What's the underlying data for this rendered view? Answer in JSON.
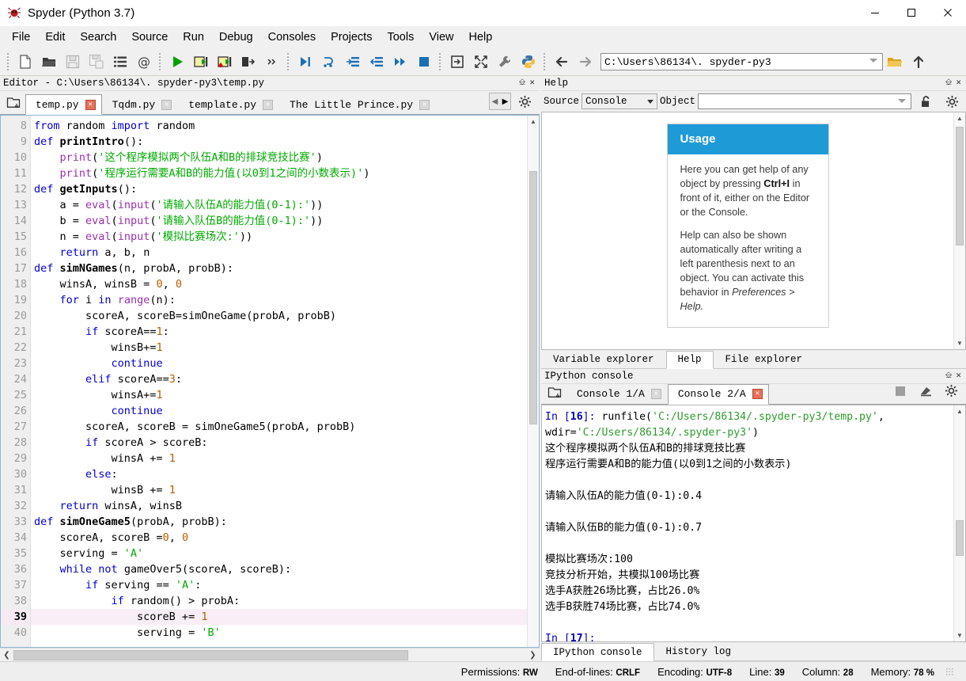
{
  "window": {
    "title": "Spyder (Python 3.7)",
    "app_icon": "spyder-icon",
    "minimize": "–",
    "maximize": "□",
    "close": "✕"
  },
  "menubar": {
    "items": [
      {
        "label": "File",
        "name": "menu-file"
      },
      {
        "label": "Edit",
        "name": "menu-edit"
      },
      {
        "label": "Search",
        "name": "menu-search"
      },
      {
        "label": "Source",
        "name": "menu-source"
      },
      {
        "label": "Run",
        "name": "menu-run"
      },
      {
        "label": "Debug",
        "name": "menu-debug"
      },
      {
        "label": "Consoles",
        "name": "menu-consoles"
      },
      {
        "label": "Projects",
        "name": "menu-projects"
      },
      {
        "label": "Tools",
        "name": "menu-tools"
      },
      {
        "label": "View",
        "name": "menu-view"
      },
      {
        "label": "Help",
        "name": "menu-help"
      }
    ]
  },
  "toolbar": {
    "path_value": "C:\\Users\\86134\\. spyder-py3",
    "icons": [
      "new-file-icon",
      "open-file-icon",
      "save-file-icon",
      "save-all-icon",
      "file-switcher-icon",
      "find-symbol-icon",
      "run-icon",
      "run-cell-icon",
      "run-cell-advance-icon",
      "run-selection-icon",
      "more-options-icon",
      "debug-icon",
      "step-over-icon",
      "step-into-icon",
      "step-return-icon",
      "continue-icon",
      "stop-debug-icon",
      "maximize-pane-icon",
      "fullscreen-icon",
      "preferences-icon",
      "pythonpath-icon",
      "back-icon",
      "forward-icon",
      "browse-folder-icon",
      "parent-dir-icon"
    ]
  },
  "editor": {
    "pane_title": "Editor - C:\\Users\\86134\\. spyder-py3\\temp.py",
    "tabs": [
      {
        "label": "temp.py",
        "active": true
      },
      {
        "label": "Tqdm.py",
        "active": false
      },
      {
        "label": "template.py",
        "active": false
      },
      {
        "label": "The Little Prince.py",
        "active": false
      }
    ],
    "current_line": 39,
    "first_line": 8,
    "lines": [
      {
        "n": 8,
        "tokens": [
          [
            "k",
            "from"
          ],
          [
            "id",
            " random "
          ],
          [
            "k",
            "import"
          ],
          [
            "id",
            " random"
          ]
        ]
      },
      {
        "n": 9,
        "tokens": [
          [
            "k",
            "def"
          ],
          [
            "id",
            " "
          ],
          [
            "fn",
            "printIntro"
          ],
          [
            "op",
            "():"
          ]
        ]
      },
      {
        "n": 10,
        "tokens": [
          [
            "id",
            "    "
          ],
          [
            "bi",
            "print"
          ],
          [
            "op",
            "("
          ],
          [
            "st",
            "'这个程序模拟两个队伍A和B的排球竞技比赛'"
          ],
          [
            "op",
            ")"
          ]
        ]
      },
      {
        "n": 11,
        "tokens": [
          [
            "id",
            "    "
          ],
          [
            "bi",
            "print"
          ],
          [
            "op",
            "("
          ],
          [
            "st",
            "'程序运行需要A和B的能力值(以0到1之间的小数表示)'"
          ],
          [
            "op",
            ")"
          ]
        ]
      },
      {
        "n": 12,
        "tokens": [
          [
            "k",
            "def"
          ],
          [
            "id",
            " "
          ],
          [
            "fn",
            "getInputs"
          ],
          [
            "op",
            "():"
          ]
        ]
      },
      {
        "n": 13,
        "tokens": [
          [
            "id",
            "    a = "
          ],
          [
            "bi",
            "eval"
          ],
          [
            "op",
            "("
          ],
          [
            "bi",
            "input"
          ],
          [
            "op",
            "("
          ],
          [
            "st",
            "'请输入队伍A的能力值(0-1):'"
          ],
          [
            "op",
            "))"
          ]
        ]
      },
      {
        "n": 14,
        "tokens": [
          [
            "id",
            "    b = "
          ],
          [
            "bi",
            "eval"
          ],
          [
            "op",
            "("
          ],
          [
            "bi",
            "input"
          ],
          [
            "op",
            "("
          ],
          [
            "st",
            "'请输入队伍B的能力值(0-1):'"
          ],
          [
            "op",
            "))"
          ]
        ]
      },
      {
        "n": 15,
        "tokens": [
          [
            "id",
            "    n = "
          ],
          [
            "bi",
            "eval"
          ],
          [
            "op",
            "("
          ],
          [
            "bi",
            "input"
          ],
          [
            "op",
            "("
          ],
          [
            "st",
            "'模拟比赛场次:'"
          ],
          [
            "op",
            "))"
          ]
        ]
      },
      {
        "n": 16,
        "tokens": [
          [
            "id",
            "    "
          ],
          [
            "k",
            "return"
          ],
          [
            "id",
            " a, b, n"
          ]
        ]
      },
      {
        "n": 17,
        "tokens": [
          [
            "k",
            "def"
          ],
          [
            "id",
            " "
          ],
          [
            "fn",
            "simNGames"
          ],
          [
            "op",
            "(n, probA, probB):"
          ]
        ]
      },
      {
        "n": 18,
        "tokens": [
          [
            "id",
            "    winsA, winsB = "
          ],
          [
            "nm",
            "0"
          ],
          [
            "op",
            ", "
          ],
          [
            "nm",
            "0"
          ]
        ]
      },
      {
        "n": 19,
        "tokens": [
          [
            "id",
            "    "
          ],
          [
            "k",
            "for"
          ],
          [
            "id",
            " i "
          ],
          [
            "k",
            "in"
          ],
          [
            "id",
            " "
          ],
          [
            "bi",
            "range"
          ],
          [
            "op",
            "(n):"
          ]
        ]
      },
      {
        "n": 20,
        "tokens": [
          [
            "id",
            "        scoreA, scoreB=simOneGame(probA, probB)"
          ]
        ]
      },
      {
        "n": 21,
        "tokens": [
          [
            "id",
            "        "
          ],
          [
            "k",
            "if"
          ],
          [
            "id",
            " scoreA=="
          ],
          [
            "nm",
            "1"
          ],
          [
            "op",
            ":"
          ]
        ]
      },
      {
        "n": 22,
        "tokens": [
          [
            "id",
            "            winsB+="
          ],
          [
            "nm",
            "1"
          ]
        ]
      },
      {
        "n": 23,
        "tokens": [
          [
            "id",
            "            "
          ],
          [
            "k",
            "continue"
          ]
        ]
      },
      {
        "n": 24,
        "tokens": [
          [
            "id",
            "        "
          ],
          [
            "k",
            "elif"
          ],
          [
            "id",
            " scoreA=="
          ],
          [
            "nm",
            "3"
          ],
          [
            "op",
            ":"
          ]
        ]
      },
      {
        "n": 25,
        "tokens": [
          [
            "id",
            "            winsA+="
          ],
          [
            "nm",
            "1"
          ]
        ]
      },
      {
        "n": 26,
        "tokens": [
          [
            "id",
            "            "
          ],
          [
            "k",
            "continue"
          ]
        ]
      },
      {
        "n": 27,
        "tokens": [
          [
            "id",
            "        scoreA, scoreB = simOneGame5(probA, probB)"
          ]
        ]
      },
      {
        "n": 28,
        "tokens": [
          [
            "id",
            "        "
          ],
          [
            "k",
            "if"
          ],
          [
            "id",
            " scoreA > scoreB:"
          ]
        ]
      },
      {
        "n": 29,
        "tokens": [
          [
            "id",
            "            winsA += "
          ],
          [
            "nm",
            "1"
          ]
        ]
      },
      {
        "n": 30,
        "tokens": [
          [
            "id",
            "        "
          ],
          [
            "k",
            "else"
          ],
          [
            "op",
            ":"
          ]
        ]
      },
      {
        "n": 31,
        "tokens": [
          [
            "id",
            "            winsB += "
          ],
          [
            "nm",
            "1"
          ]
        ]
      },
      {
        "n": 32,
        "tokens": [
          [
            "id",
            "    "
          ],
          [
            "k",
            "return"
          ],
          [
            "id",
            " winsA, winsB"
          ]
        ]
      },
      {
        "n": 33,
        "tokens": [
          [
            "k",
            "def"
          ],
          [
            "id",
            " "
          ],
          [
            "fn",
            "simOneGame5"
          ],
          [
            "op",
            "(probA, probB):"
          ]
        ]
      },
      {
        "n": 34,
        "tokens": [
          [
            "id",
            "    scoreA, scoreB ="
          ],
          [
            "nm",
            "0"
          ],
          [
            "op",
            ", "
          ],
          [
            "nm",
            "0"
          ]
        ]
      },
      {
        "n": 35,
        "tokens": [
          [
            "id",
            "    serving = "
          ],
          [
            "st",
            "'A'"
          ]
        ]
      },
      {
        "n": 36,
        "tokens": [
          [
            "id",
            "    "
          ],
          [
            "k",
            "while"
          ],
          [
            "id",
            " "
          ],
          [
            "k",
            "not"
          ],
          [
            "id",
            " gameOver5(scoreA, scoreB):"
          ]
        ]
      },
      {
        "n": 37,
        "tokens": [
          [
            "id",
            "        "
          ],
          [
            "k",
            "if"
          ],
          [
            "id",
            " serving == "
          ],
          [
            "st",
            "'A'"
          ],
          [
            "op",
            ":"
          ]
        ]
      },
      {
        "n": 38,
        "tokens": [
          [
            "id",
            "            "
          ],
          [
            "k",
            "if"
          ],
          [
            "id",
            " random() > probA:"
          ]
        ]
      },
      {
        "n": 39,
        "tokens": [
          [
            "id",
            "                scoreB += "
          ],
          [
            "nm",
            "1"
          ]
        ],
        "current": true
      },
      {
        "n": 40,
        "tokens": [
          [
            "id",
            "                serving = "
          ],
          [
            "st",
            "'B'"
          ]
        ]
      }
    ]
  },
  "help": {
    "pane_title": "Help",
    "source_label": "Source",
    "source_value": "Console",
    "object_label": "Object",
    "object_value": "",
    "lock_icon": "lock-open-icon",
    "options_icon": "gear-icon",
    "card": {
      "heading": "Usage",
      "paragraph1_pre": "Here you can get help of any object by pressing ",
      "paragraph1_bold": "Ctrl+I",
      "paragraph1_post": " in front of it, either on the Editor or the Console.",
      "paragraph2_pre": "Help can also be shown automatically after writing a left parenthesis next to an object. You can activate this behavior in ",
      "paragraph2_italic": "Preferences > Help."
    },
    "tabs": [
      {
        "label": "Variable explorer",
        "active": false
      },
      {
        "label": "Help",
        "active": true
      },
      {
        "label": "File explorer",
        "active": false
      }
    ]
  },
  "console": {
    "pane_title": "IPython console",
    "tabs": [
      {
        "label": "Console 1/A",
        "active": false
      },
      {
        "label": "Console 2/A",
        "active": true
      }
    ],
    "toolbar_icons": [
      "stop-icon",
      "remove-all-variables-icon",
      "gear-icon"
    ],
    "browse_icon": "browse-tabs-icon",
    "output": [
      {
        "type": "prompt",
        "prompt_pre": "In [",
        "prompt_num": "16",
        "prompt_post": "]: ",
        "code_pre": "runfile(",
        "code_str": "'C:/Users/86134/.spyder-py3/temp.py'",
        "code_post": ","
      },
      {
        "type": "cont",
        "pre": "wdir=",
        "str": "'C:/Users/86134/.spyder-py3'",
        "post": ")"
      },
      {
        "type": "out",
        "text": "这个程序模拟两个队伍A和B的排球竞技比赛"
      },
      {
        "type": "out",
        "text": "程序运行需要A和B的能力值(以0到1之间的小数表示)"
      },
      {
        "type": "blank",
        "text": ""
      },
      {
        "type": "out",
        "text": "请输入队伍A的能力值(0-1):0.4"
      },
      {
        "type": "blank",
        "text": ""
      },
      {
        "type": "out",
        "text": "请输入队伍B的能力值(0-1):0.7"
      },
      {
        "type": "blank",
        "text": ""
      },
      {
        "type": "out",
        "text": "模拟比赛场次:100"
      },
      {
        "type": "out",
        "text": "竞技分析开始，共模拟100场比赛"
      },
      {
        "type": "out",
        "text": "选手A获胜26场比赛，占比26.0%"
      },
      {
        "type": "out",
        "text": "选手B获胜74场比赛，占比74.0%"
      },
      {
        "type": "blank",
        "text": ""
      },
      {
        "type": "prompt_only",
        "prompt_pre": "In [",
        "prompt_num": "17",
        "prompt_post": "]:"
      }
    ],
    "tabs_bottom": [
      {
        "label": "IPython console",
        "active": true
      },
      {
        "label": "History log",
        "active": false
      }
    ]
  },
  "statusbar": {
    "permissions_label": "Permissions:",
    "permissions_value": "RW",
    "eol_label": "End-of-lines:",
    "eol_value": "CRLF",
    "encoding_label": "Encoding:",
    "encoding_value": "UTF-8",
    "line_label": "Line:",
    "line_value": "39",
    "column_label": "Column:",
    "column_value": "28",
    "memory_label": "Memory:",
    "memory_value": "78 %"
  },
  "colors": {
    "accent_blue": "#1e9ad6",
    "keyword": "#0000cf",
    "string": "#00aa00",
    "builtin": "#9b30b0",
    "number": "#b85c00",
    "current_line": "#f9eef6"
  }
}
